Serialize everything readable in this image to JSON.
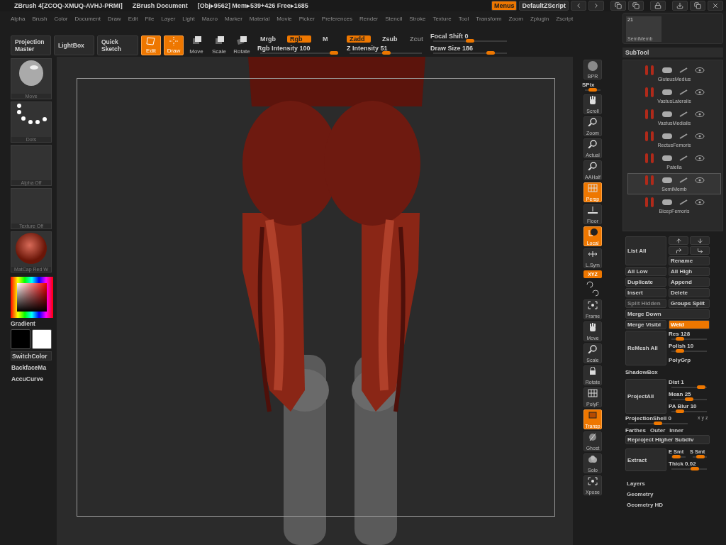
{
  "title_bar": {
    "app": "ZBrush 4[ZCOQ-XMUQ-AVHJ-PRMI]",
    "document": "ZBrush Document",
    "stats": "[Obj▸9562] Mem▸539+426 Free▸1685",
    "buttons": [
      {
        "label": "Menus",
        "selected": true
      },
      {
        "label": "DefaultZScript",
        "selected": false
      }
    ]
  },
  "menu_bar": [
    "Alpha",
    "Brush",
    "Color",
    "Document",
    "Draw",
    "Edit",
    "File",
    "Layer",
    "Light",
    "Macro",
    "Marker",
    "Material",
    "Movie",
    "Picker",
    "Preferences",
    "Render",
    "Stencil",
    "Stroke",
    "Texture",
    "Tool",
    "Transform",
    "Zoom",
    "Zplugin",
    "Zscript"
  ],
  "top_shelf": {
    "buttons": [
      "Projection Master",
      "LightBox",
      "Quick Sketch"
    ],
    "modes": [
      {
        "label": "Edit",
        "selected": true
      },
      {
        "label": "Draw",
        "selected": true
      },
      {
        "label": "Move",
        "selected": false
      },
      {
        "label": "Scale",
        "selected": false
      },
      {
        "label": "Rotate",
        "selected": false
      }
    ],
    "color_modes": [
      {
        "label": "Mrgb",
        "selected": false
      },
      {
        "label": "Rgb",
        "selected": true
      },
      {
        "label": "M",
        "selected": false
      }
    ],
    "z_modes": [
      {
        "label": "Zadd",
        "selected": true,
        "disabled": false
      },
      {
        "label": "Zsub",
        "selected": false,
        "disabled": false
      },
      {
        "label": "Zcut",
        "selected": false,
        "disabled": true
      }
    ],
    "rgb_intensity": {
      "label": "Rgb Intensity",
      "value": "100",
      "level": 1.0
    },
    "z_intensity": {
      "label": "Z Intensity",
      "value": "51",
      "level": 0.51
    },
    "focal_shift": {
      "label": "Focal Shift",
      "value": "0",
      "level": 0.5
    },
    "draw_size": {
      "label": "Draw Size",
      "value": "186",
      "level": 0.82
    }
  },
  "left_shelf": {
    "thumbnails": [
      {
        "label": "Move",
        "kind": "brush"
      },
      {
        "label": "Dots",
        "kind": "stroke"
      },
      {
        "label": "Alpha Off",
        "kind": "empty"
      },
      {
        "label": "Texture Off",
        "kind": "empty"
      },
      {
        "label": "MatCap Red W",
        "kind": "material"
      }
    ],
    "gradient": "Gradient",
    "swatches": [
      {
        "color": "#000000"
      },
      {
        "color": "#ffffff"
      }
    ],
    "buttons": [
      {
        "label": "SwitchColor",
        "boxed": true
      },
      {
        "label": "BackfaceMa",
        "boxed": false
      },
      {
        "label": "AccuCurve",
        "boxed": false
      }
    ]
  },
  "right_shelf": [
    {
      "kind": "tool",
      "label": "BPR",
      "on": false
    },
    {
      "kind": "slider",
      "label": "SPix",
      "level": 0.5
    },
    {
      "kind": "tool",
      "label": "Scroll",
      "on": false
    },
    {
      "kind": "tool",
      "label": "Zoom",
      "on": false
    },
    {
      "kind": "tool",
      "label": "Actual",
      "on": false
    },
    {
      "kind": "tool",
      "label": "AAHalf",
      "on": false
    },
    {
      "kind": "tool",
      "label": "Persp",
      "on": true
    },
    {
      "kind": "tool",
      "label": "Floor",
      "on": false
    },
    {
      "kind": "tool",
      "label": "Local",
      "on": true
    },
    {
      "kind": "tool",
      "label": "L.Sym",
      "on": false
    },
    {
      "kind": "small",
      "label": "XYZ",
      "on": true
    },
    {
      "kind": "rotation"
    },
    {
      "kind": "tool",
      "label": "Frame",
      "on": false
    },
    {
      "kind": "tool",
      "label": "Move",
      "on": false
    },
    {
      "kind": "tool",
      "label": "Scale",
      "on": false
    },
    {
      "kind": "tool",
      "label": "Rotate",
      "on": false
    },
    {
      "kind": "tool",
      "label": "PolyF",
      "on": false
    },
    {
      "kind": "tool",
      "label": "Transp",
      "on": true
    },
    {
      "kind": "tool",
      "label": "Ghost",
      "on": false
    },
    {
      "kind": "tool",
      "label": "Solo",
      "on": false
    },
    {
      "kind": "tool",
      "label": "Xpose",
      "on": false
    }
  ],
  "tool_thumbnail": {
    "count": "21",
    "name": "SemiMemb"
  },
  "subtool": {
    "title": "SubTool",
    "items": [
      {
        "name": "GluteusMedius",
        "selected": false
      },
      {
        "name": "VastusLateralis",
        "selected": false
      },
      {
        "name": "VastusMedialis",
        "selected": false
      },
      {
        "name": "RectusFemoris",
        "selected": false
      },
      {
        "name": "Patella",
        "selected": false
      },
      {
        "name": "SemiMemb",
        "selected": true
      },
      {
        "name": "BicepFemoris",
        "selected": false
      }
    ],
    "list_all": "List All",
    "rename": "Rename",
    "button_rows": [
      [
        {
          "label": "All Low",
          "on": false,
          "disabled": false
        },
        {
          "label": "All High",
          "on": false,
          "disabled": false
        }
      ],
      [
        {
          "label": "Duplicate",
          "on": false,
          "disabled": false
        },
        {
          "label": "Append",
          "on": false,
          "disabled": false
        }
      ],
      [
        {
          "label": "Insert",
          "on": false,
          "disabled": false
        },
        {
          "label": "Delete",
          "on": false,
          "disabled": false
        }
      ],
      [
        {
          "label": "Split Hidden",
          "on": false,
          "disabled": true
        },
        {
          "label": "Groups Split",
          "on": false,
          "disabled": false
        }
      ],
      [
        {
          "label": "Merge Down",
          "on": false,
          "disabled": false
        }
      ],
      [
        {
          "label": "Merge Visibl",
          "on": false,
          "disabled": false
        },
        {
          "label": "Weld",
          "on": true,
          "disabled": false
        }
      ]
    ],
    "remesh": {
      "button": "ReMesh All",
      "sliders": [
        {
          "label": "Res",
          "value": "128",
          "level": 0.15
        },
        {
          "label": "Polish",
          "value": "10",
          "level": 0.15
        }
      ],
      "polygroup": "PolyGrp"
    },
    "shadowbox": "ShadowBox",
    "project": {
      "button": "ProjectAll",
      "sliders": [
        {
          "label": "Dist",
          "value": "1",
          "level": 0.95
        },
        {
          "label": "Mean",
          "value": "25",
          "level": 0.5
        },
        {
          "label": "PA Blur",
          "value": "10",
          "level": 0.15
        }
      ]
    },
    "projection_shell": {
      "label": "ProjectionShell",
      "value": "0",
      "level": 0.5,
      "axes": "x y z"
    },
    "shell_options": [
      "Farthes",
      "Outer",
      "Inner"
    ],
    "reproject": "Reproject Higher Subdiv",
    "extract": {
      "button": "Extract",
      "smooth": [
        {
          "label": "E Smt",
          "level": 0.1
        },
        {
          "label": "S Smt",
          "level": 0.6
        }
      ],
      "thickness": {
        "label": "Thick",
        "value": "0.02",
        "level": 0.7
      }
    }
  },
  "palettes": [
    "Layers",
    "Geometry",
    "Geometry HD"
  ]
}
